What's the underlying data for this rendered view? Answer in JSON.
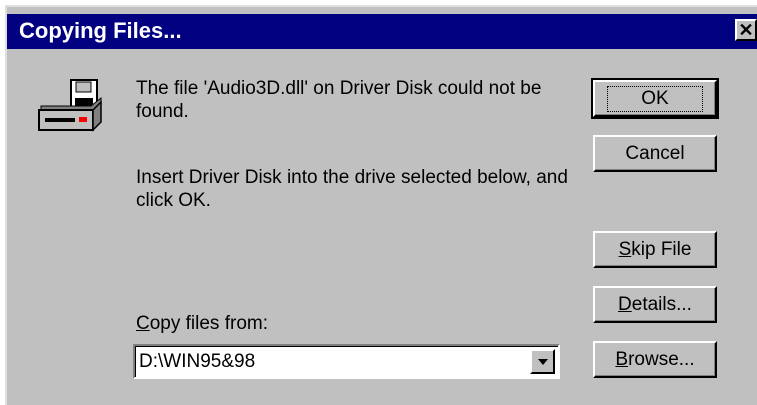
{
  "window": {
    "title": "Copying Files...",
    "close_glyph": "✕"
  },
  "message": {
    "line1": "The file 'Audio3D.dll' on Driver Disk could not be found.",
    "line2": "Insert Driver Disk into the drive selected below, and click OK."
  },
  "copy_from": {
    "label_mnemonic": "C",
    "label_rest": "opy files from:",
    "value": "D:\\WIN95&98"
  },
  "buttons": {
    "ok": "OK",
    "cancel": "Cancel",
    "skip_mnemonic": "S",
    "skip_rest": "kip File",
    "details_mnemonic": "D",
    "details_rest": "etails...",
    "browse_mnemonic": "B",
    "browse_rest": "rowse..."
  },
  "icons": {
    "drive": "disk-drive-icon",
    "dropdown": "chevron-down-icon",
    "close": "close-icon"
  },
  "colors": {
    "titlebar": "#000080",
    "face": "#c0c0c0",
    "title_text": "#ffffff"
  }
}
